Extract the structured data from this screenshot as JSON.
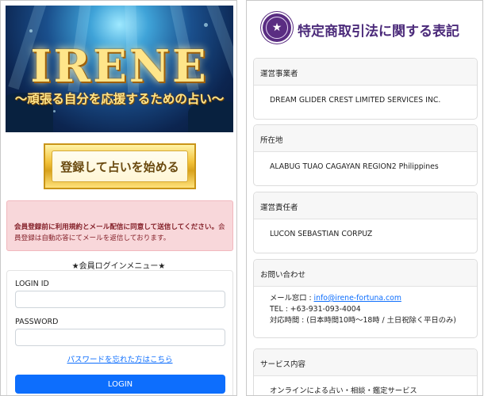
{
  "left": {
    "hero": {
      "title": "IRENE",
      "subtitle": "〜頑張る自分を応援するための占い〜"
    },
    "start_button": "登録して占いを始める",
    "alert": {
      "bold": "会員登録前に利用規約とメール配信に同意して送信してください。",
      "normal": "会員登録は自動応答にてメールを返信しております。"
    },
    "login": {
      "heading": "★会員ログインメニュー★",
      "id_label": "LOGIN ID",
      "id_value": "",
      "password_label": "PASSWORD",
      "password_value": "",
      "forgot_link": "パスワードを忘れた方はこちら",
      "login_button": "LOGIN"
    }
  },
  "right": {
    "title": "特定商取引法に関する表記",
    "sections": [
      {
        "head": "運営事業者",
        "lines": [
          "DREAM GLIDER CREST LIMITED SERVICES INC."
        ]
      },
      {
        "head": "所在地",
        "lines": [
          "ALABUG TUAO CAGAYAN REGION2 Philippines"
        ]
      },
      {
        "head": "運営責任者",
        "lines": [
          "LUCON SEBASTIAN CORPUZ"
        ]
      },
      {
        "head": "お問い合わせ",
        "mail_label": "メール窓口 : ",
        "mail": "info@irene-fortuna.com",
        "tel": "TEL : +63-931-093-4004",
        "hours": "対応時間 : (日本時間10時〜18時 / 土日祝除く平日のみ)"
      },
      {
        "head": "サービス内容",
        "lines": [
          "オンラインによる占い・相談・鑑定サービス"
        ]
      }
    ]
  },
  "colors": {
    "primary": "#0d6efd",
    "alert_bg": "#f8d7da",
    "alert_text": "#842029",
    "brand_purple": "#4b2a7a",
    "gold": "#f2c23a"
  },
  "icons": {
    "logo": "star-emblem-icon"
  }
}
